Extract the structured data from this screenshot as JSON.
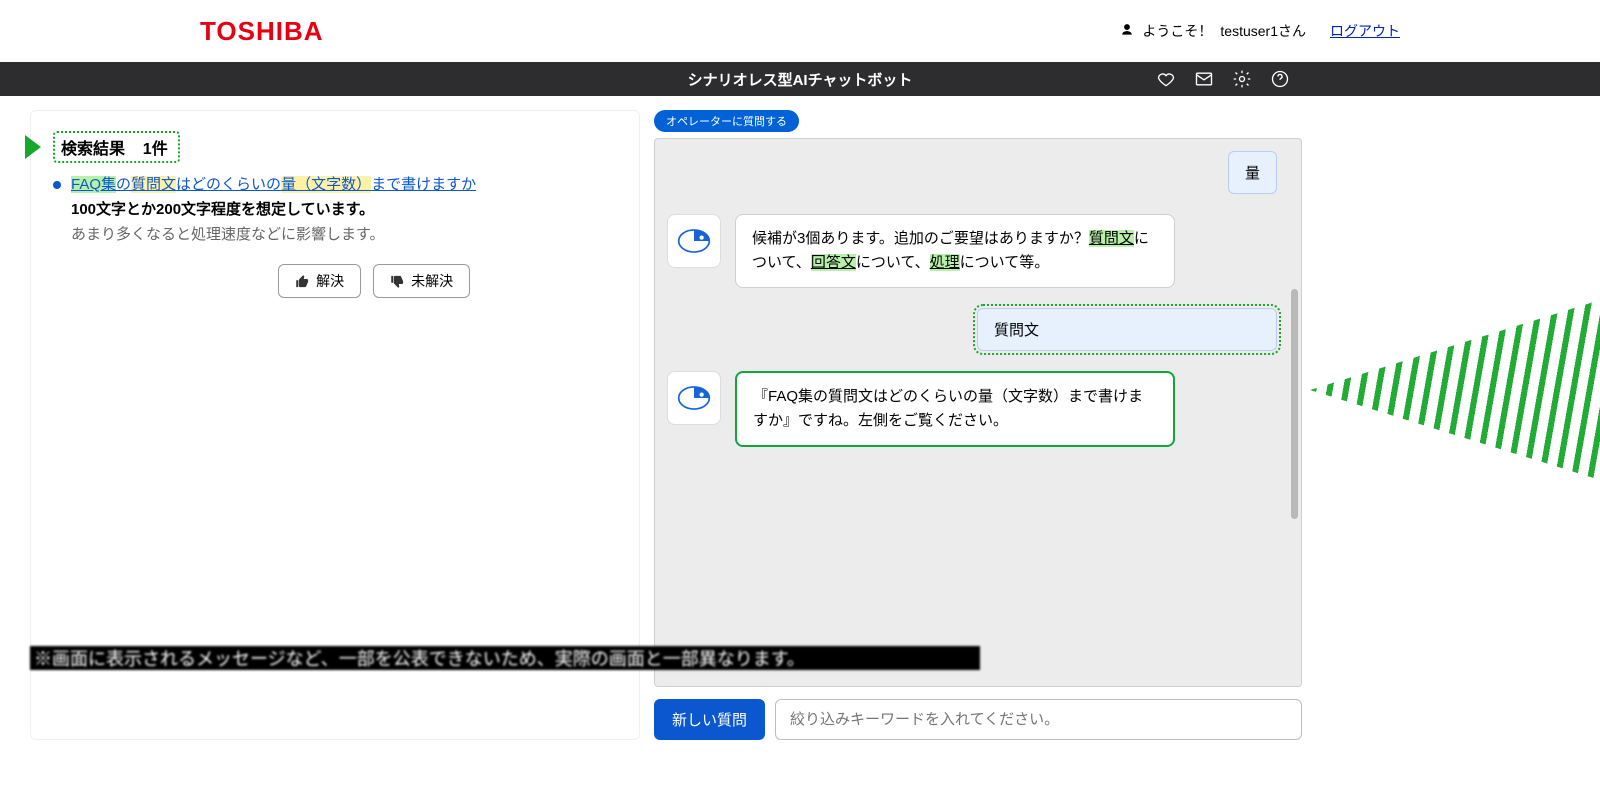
{
  "brand": "TOSHIBA",
  "header": {
    "welcome_prefix": "ようこそ！",
    "username": "testuser1さん",
    "logout": "ログアウト"
  },
  "darkbar": {
    "title": "シナリオレス型AIチャットボット"
  },
  "left": {
    "results_label": "検索結果",
    "results_count": "1件",
    "faq": {
      "link_parts": {
        "p1": "FAQ集",
        "p2": "の",
        "p3": "質問文",
        "p4": "はどのくらいの",
        "p5": "量（文字数）",
        "p6": "まで書けますか"
      },
      "bold": "100文字とか200文字程度を想定しています。",
      "note": "あまり多くなると処理速度などに影響します。"
    },
    "feedback": {
      "resolved": "解決",
      "unresolved": "未解決"
    }
  },
  "right": {
    "operator_pill": "オペレーターに質問する",
    "messages": {
      "u1": "量",
      "bot1": {
        "a": "候補が3個あります。追加のご要望はありますか？",
        "k1": "質問文",
        "b": "について、",
        "k2": "回答文",
        "c": "について、",
        "k3": "処理",
        "d": "について等。"
      },
      "u2": "質問文",
      "bot2": "『FAQ集の質問文はどのくらいの量（文字数）まで書けますか』ですね。左側をご覧ください。"
    },
    "new_question": "新しい質問",
    "input_placeholder": "絞り込みキーワードを入れてください。"
  },
  "redacted_note": "※画面に表示されるメッセージなど、一部を公表できないため、実際の画面と一部異なります。"
}
